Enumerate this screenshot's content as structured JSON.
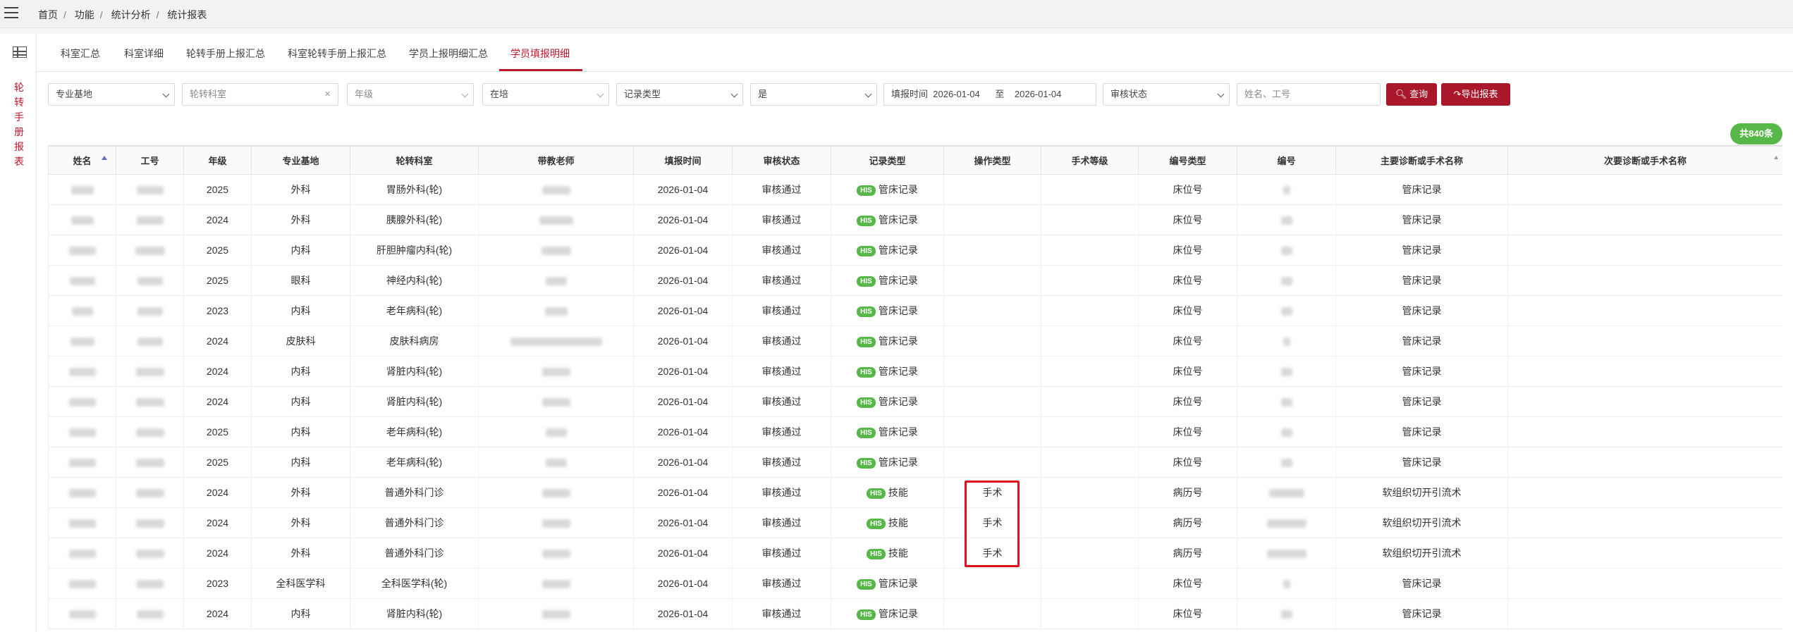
{
  "breadcrumb": [
    "首页",
    "功能",
    "统计分析",
    "统计报表"
  ],
  "sidebar": {
    "vertical_title": "轮转手册报表"
  },
  "tabs": [
    {
      "label": "科室汇总",
      "active": false
    },
    {
      "label": "科室详细",
      "active": false
    },
    {
      "label": "轮转手册上报汇总",
      "active": false
    },
    {
      "label": "科室轮转手册上报汇总",
      "active": false
    },
    {
      "label": "学员上报明细汇总",
      "active": false
    },
    {
      "label": "学员填报明细",
      "active": true
    }
  ],
  "filters": {
    "base": "专业基地",
    "dept": "轮转科室",
    "grade": "年级",
    "status": "在培",
    "record_type": "记录类型",
    "yesno": "是",
    "date_label": "填报时间",
    "date_from": "2026-01-04",
    "date_to_label": "至",
    "date_to": "2026-01-04",
    "audit": "审核状态",
    "search_placeholder": "姓名、工号",
    "query_btn": "查询",
    "export_btn": "导出报表"
  },
  "total_badge": "共840条",
  "accent": "#a8172a",
  "his_color": "#57b849",
  "table": {
    "headers": [
      "姓名",
      "工号",
      "年级",
      "专业基地",
      "轮转科室",
      "带教老师",
      "填报时间",
      "审核状态",
      "记录类型",
      "操作类型",
      "手术等级",
      "编号类型",
      "编号",
      "主要诊断或手术名称",
      "次要诊断或手术名称"
    ],
    "rows": [
      {
        "grade": "2025",
        "base": "外科",
        "dept": "胃肠外科(轮)",
        "date": "2026-01-04",
        "audit": "审核通过",
        "rtype": "管床记录",
        "op": "",
        "level": "",
        "idtype": "床位号",
        "main": "管床记录",
        "sec": ""
      },
      {
        "grade": "2024",
        "base": "外科",
        "dept": "胰腺外科(轮)",
        "date": "2026-01-04",
        "audit": "审核通过",
        "rtype": "管床记录",
        "op": "",
        "level": "",
        "idtype": "床位号",
        "main": "管床记录",
        "sec": ""
      },
      {
        "grade": "2025",
        "base": "内科",
        "dept": "肝胆肿瘤内科(轮)",
        "date": "2026-01-04",
        "audit": "审核通过",
        "rtype": "管床记录",
        "op": "",
        "level": "",
        "idtype": "床位号",
        "main": "管床记录",
        "sec": ""
      },
      {
        "grade": "2025",
        "base": "眼科",
        "dept": "神经内科(轮)",
        "date": "2026-01-04",
        "audit": "审核通过",
        "rtype": "管床记录",
        "op": "",
        "level": "",
        "idtype": "床位号",
        "main": "管床记录",
        "sec": ""
      },
      {
        "grade": "2023",
        "base": "内科",
        "dept": "老年病科(轮)",
        "date": "2026-01-04",
        "audit": "审核通过",
        "rtype": "管床记录",
        "op": "",
        "level": "",
        "idtype": "床位号",
        "main": "管床记录",
        "sec": ""
      },
      {
        "grade": "2024",
        "base": "皮肤科",
        "dept": "皮肤科病房",
        "date": "2026-01-04",
        "audit": "审核通过",
        "rtype": "管床记录",
        "op": "",
        "level": "",
        "idtype": "床位号",
        "main": "管床记录",
        "sec": ""
      },
      {
        "grade": "2024",
        "base": "内科",
        "dept": "肾脏内科(轮)",
        "date": "2026-01-04",
        "audit": "审核通过",
        "rtype": "管床记录",
        "op": "",
        "level": "",
        "idtype": "床位号",
        "main": "管床记录",
        "sec": ""
      },
      {
        "grade": "2024",
        "base": "内科",
        "dept": "肾脏内科(轮)",
        "date": "2026-01-04",
        "audit": "审核通过",
        "rtype": "管床记录",
        "op": "",
        "level": "",
        "idtype": "床位号",
        "main": "管床记录",
        "sec": ""
      },
      {
        "grade": "2025",
        "base": "内科",
        "dept": "老年病科(轮)",
        "date": "2026-01-04",
        "audit": "审核通过",
        "rtype": "管床记录",
        "op": "",
        "level": "",
        "idtype": "床位号",
        "main": "管床记录",
        "sec": ""
      },
      {
        "grade": "2025",
        "base": "内科",
        "dept": "老年病科(轮)",
        "date": "2026-01-04",
        "audit": "审核通过",
        "rtype": "管床记录",
        "op": "",
        "level": "",
        "idtype": "床位号",
        "main": "管床记录",
        "sec": ""
      },
      {
        "grade": "2024",
        "base": "外科",
        "dept": "普通外科门诊",
        "date": "2026-01-04",
        "audit": "审核通过",
        "rtype": "技能",
        "op": "手术",
        "level": "",
        "idtype": "病历号",
        "main": "软组织切开引流术",
        "sec": ""
      },
      {
        "grade": "2024",
        "base": "外科",
        "dept": "普通外科门诊",
        "date": "2026-01-04",
        "audit": "审核通过",
        "rtype": "技能",
        "op": "手术",
        "level": "",
        "idtype": "病历号",
        "main": "软组织切开引流术",
        "sec": ""
      },
      {
        "grade": "2024",
        "base": "外科",
        "dept": "普通外科门诊",
        "date": "2026-01-04",
        "audit": "审核通过",
        "rtype": "技能",
        "op": "手术",
        "level": "",
        "idtype": "病历号",
        "main": "软组织切开引流术",
        "sec": ""
      },
      {
        "grade": "2023",
        "base": "全科医学科",
        "dept": "全科医学科(轮)",
        "date": "2026-01-04",
        "audit": "审核通过",
        "rtype": "管床记录",
        "op": "",
        "level": "",
        "idtype": "床位号",
        "main": "管床记录",
        "sec": ""
      },
      {
        "grade": "2024",
        "base": "内科",
        "dept": "肾脏内科(轮)",
        "date": "2026-01-04",
        "audit": "审核通过",
        "rtype": "管床记录",
        "op": "",
        "level": "",
        "idtype": "床位号",
        "main": "管床记录",
        "sec": ""
      }
    ]
  }
}
